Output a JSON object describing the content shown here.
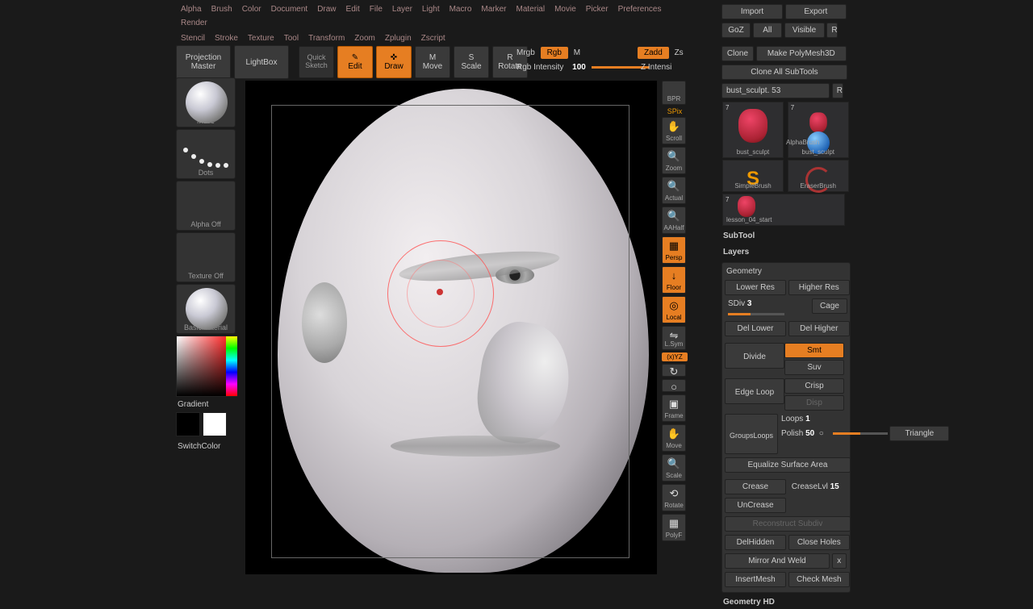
{
  "menu": {
    "row1": [
      "Alpha",
      "Brush",
      "Color",
      "Document",
      "Draw",
      "Edit",
      "File",
      "Layer",
      "Light",
      "Macro",
      "Marker",
      "Material",
      "Movie",
      "Picker",
      "Preferences",
      "Render"
    ],
    "row2": [
      "Stencil",
      "Stroke",
      "Texture",
      "Tool",
      "Transform",
      "Zoom",
      "Zplugin",
      "Zscript"
    ]
  },
  "toolbar": {
    "projection_master": "Projection\nMaster",
    "lightbox": "LightBox",
    "quick_sketch": "Quick\nSketch",
    "edit": "Edit",
    "draw": "Draw",
    "move": "Move",
    "scale": "Scale",
    "rotate": "Rotate"
  },
  "header": {
    "mrgb": "Mrgb",
    "rgb": "Rgb",
    "m": "M",
    "rgb_intensity_lbl": "Rgb Intensity",
    "rgb_intensity_val": "100",
    "zadd": "Zadd",
    "zs": "Zs",
    "z_intensity": "Z Intensi"
  },
  "left": {
    "brush": "Move",
    "stroke": "Dots",
    "alpha": "Alpha Off",
    "texture": "Texture Off",
    "material": "BasicMaterial",
    "gradient": "Gradient",
    "switch": "SwitchColor"
  },
  "rtray": {
    "bpr": "BPR",
    "spix": "SPix",
    "scroll": "Scroll",
    "zoom": "Zoom",
    "actual": "Actual",
    "aahalf": "AAHalf",
    "persp": "Persp",
    "floor": "Floor",
    "local": "Local",
    "lsym": "L.Sym",
    "xyz": "(x)YZ",
    "frame": "Frame",
    "move": "Move",
    "scale": "Scale",
    "rotate": "Rotate",
    "polyf": "PolyF"
  },
  "panel": {
    "import": "Import",
    "export": "Export",
    "goz": "GoZ",
    "all": "All",
    "visible": "Visible",
    "r": "R",
    "clone": "Clone",
    "make_polymesh": "Make PolyMesh3D",
    "clone_all": "Clone All SubTools",
    "toolname": "bust_sculpt. 53",
    "thumbs": [
      {
        "n": "7",
        "lbl": "bust_sculpt"
      },
      {
        "n": "7",
        "lbl": "bust_sculpt"
      },
      {
        "n": "",
        "lbl": "AlphaBrush"
      },
      {
        "n": "",
        "lbl": "SimpleBrush"
      },
      {
        "n": "",
        "lbl": "EraserBrush"
      },
      {
        "n": "7",
        "lbl": "lesson_04_start"
      }
    ],
    "subtool": "SubTool",
    "layers": "Layers",
    "geometry": {
      "hd": "Geometry",
      "lower": "Lower Res",
      "higher": "Higher Res",
      "sdiv_lbl": "SDiv",
      "sdiv_val": "3",
      "cage": "Cage",
      "del_lower": "Del Lower",
      "del_higher": "Del Higher",
      "divide": "Divide",
      "smt": "Smt",
      "suv": "Suv",
      "crisp": "Crisp",
      "disp": "Disp",
      "edge_loop": "Edge Loop",
      "loops_lbl": "Loops",
      "loops_val": "1",
      "polish_lbl": "Polish",
      "polish_val": "50",
      "groupsloops": "GroupsLoops",
      "triangle": "Triangle",
      "equalize": "Equalize Surface Area",
      "crease": "Crease",
      "creaselvl_lbl": "CreaseLvl",
      "creaselvl_val": "15",
      "uncrease": "UnCrease",
      "reconstruct": "Reconstruct Subdiv",
      "delhidden": "DelHidden",
      "close_holes": "Close Holes",
      "mirror": "Mirror And Weld",
      "insertmesh": "InsertMesh",
      "checkmesh": "Check Mesh"
    },
    "geometry_hd": "Geometry HD"
  }
}
